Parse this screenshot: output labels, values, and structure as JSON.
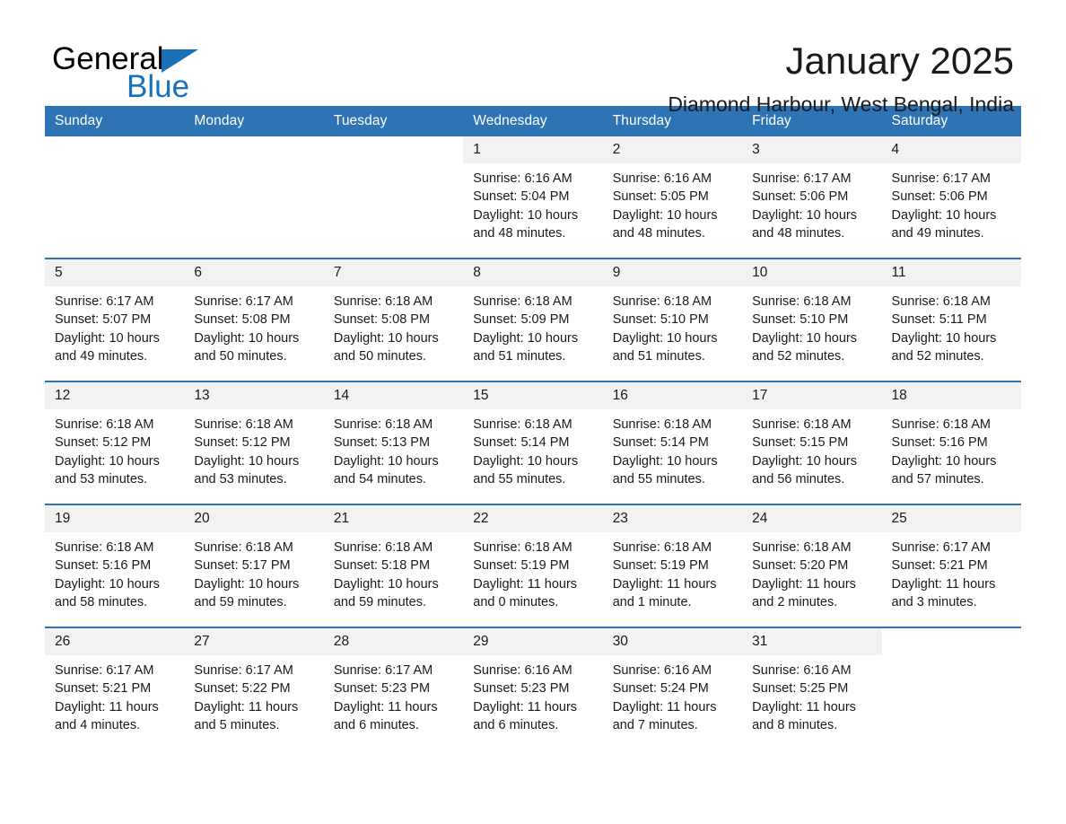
{
  "brand": {
    "line1": "General",
    "line2": "Blue",
    "triangle_icon": "triangle-icon",
    "black": "#000000",
    "blue": "#1a71b8"
  },
  "header": {
    "title": "January 2025",
    "subtitle": "Diamond Harbour, West Bengal, India"
  },
  "theme": {
    "header_blue": "#2e74b5",
    "row_divider": "#2e74b5",
    "daynum_band": "#f2f2f2",
    "text": "#1a1a1a"
  },
  "weekday_headers": [
    "Sunday",
    "Monday",
    "Tuesday",
    "Wednesday",
    "Thursday",
    "Friday",
    "Saturday"
  ],
  "weeks": [
    [
      {
        "day": "",
        "blank": true
      },
      {
        "day": "",
        "blank": true
      },
      {
        "day": "",
        "blank": true
      },
      {
        "day": "1",
        "sunrise": "Sunrise: 6:16 AM",
        "sunset": "Sunset: 5:04 PM",
        "daylight": "Daylight: 10 hours and 48 minutes."
      },
      {
        "day": "2",
        "sunrise": "Sunrise: 6:16 AM",
        "sunset": "Sunset: 5:05 PM",
        "daylight": "Daylight: 10 hours and 48 minutes."
      },
      {
        "day": "3",
        "sunrise": "Sunrise: 6:17 AM",
        "sunset": "Sunset: 5:06 PM",
        "daylight": "Daylight: 10 hours and 48 minutes."
      },
      {
        "day": "4",
        "sunrise": "Sunrise: 6:17 AM",
        "sunset": "Sunset: 5:06 PM",
        "daylight": "Daylight: 10 hours and 49 minutes."
      }
    ],
    [
      {
        "day": "5",
        "sunrise": "Sunrise: 6:17 AM",
        "sunset": "Sunset: 5:07 PM",
        "daylight": "Daylight: 10 hours and 49 minutes."
      },
      {
        "day": "6",
        "sunrise": "Sunrise: 6:17 AM",
        "sunset": "Sunset: 5:08 PM",
        "daylight": "Daylight: 10 hours and 50 minutes."
      },
      {
        "day": "7",
        "sunrise": "Sunrise: 6:18 AM",
        "sunset": "Sunset: 5:08 PM",
        "daylight": "Daylight: 10 hours and 50 minutes."
      },
      {
        "day": "8",
        "sunrise": "Sunrise: 6:18 AM",
        "sunset": "Sunset: 5:09 PM",
        "daylight": "Daylight: 10 hours and 51 minutes."
      },
      {
        "day": "9",
        "sunrise": "Sunrise: 6:18 AM",
        "sunset": "Sunset: 5:10 PM",
        "daylight": "Daylight: 10 hours and 51 minutes."
      },
      {
        "day": "10",
        "sunrise": "Sunrise: 6:18 AM",
        "sunset": "Sunset: 5:10 PM",
        "daylight": "Daylight: 10 hours and 52 minutes."
      },
      {
        "day": "11",
        "sunrise": "Sunrise: 6:18 AM",
        "sunset": "Sunset: 5:11 PM",
        "daylight": "Daylight: 10 hours and 52 minutes."
      }
    ],
    [
      {
        "day": "12",
        "sunrise": "Sunrise: 6:18 AM",
        "sunset": "Sunset: 5:12 PM",
        "daylight": "Daylight: 10 hours and 53 minutes."
      },
      {
        "day": "13",
        "sunrise": "Sunrise: 6:18 AM",
        "sunset": "Sunset: 5:12 PM",
        "daylight": "Daylight: 10 hours and 53 minutes."
      },
      {
        "day": "14",
        "sunrise": "Sunrise: 6:18 AM",
        "sunset": "Sunset: 5:13 PM",
        "daylight": "Daylight: 10 hours and 54 minutes."
      },
      {
        "day": "15",
        "sunrise": "Sunrise: 6:18 AM",
        "sunset": "Sunset: 5:14 PM",
        "daylight": "Daylight: 10 hours and 55 minutes."
      },
      {
        "day": "16",
        "sunrise": "Sunrise: 6:18 AM",
        "sunset": "Sunset: 5:14 PM",
        "daylight": "Daylight: 10 hours and 55 minutes."
      },
      {
        "day": "17",
        "sunrise": "Sunrise: 6:18 AM",
        "sunset": "Sunset: 5:15 PM",
        "daylight": "Daylight: 10 hours and 56 minutes."
      },
      {
        "day": "18",
        "sunrise": "Sunrise: 6:18 AM",
        "sunset": "Sunset: 5:16 PM",
        "daylight": "Daylight: 10 hours and 57 minutes."
      }
    ],
    [
      {
        "day": "19",
        "sunrise": "Sunrise: 6:18 AM",
        "sunset": "Sunset: 5:16 PM",
        "daylight": "Daylight: 10 hours and 58 minutes."
      },
      {
        "day": "20",
        "sunrise": "Sunrise: 6:18 AM",
        "sunset": "Sunset: 5:17 PM",
        "daylight": "Daylight: 10 hours and 59 minutes."
      },
      {
        "day": "21",
        "sunrise": "Sunrise: 6:18 AM",
        "sunset": "Sunset: 5:18 PM",
        "daylight": "Daylight: 10 hours and 59 minutes."
      },
      {
        "day": "22",
        "sunrise": "Sunrise: 6:18 AM",
        "sunset": "Sunset: 5:19 PM",
        "daylight": "Daylight: 11 hours and 0 minutes."
      },
      {
        "day": "23",
        "sunrise": "Sunrise: 6:18 AM",
        "sunset": "Sunset: 5:19 PM",
        "daylight": "Daylight: 11 hours and 1 minute."
      },
      {
        "day": "24",
        "sunrise": "Sunrise: 6:18 AM",
        "sunset": "Sunset: 5:20 PM",
        "daylight": "Daylight: 11 hours and 2 minutes."
      },
      {
        "day": "25",
        "sunrise": "Sunrise: 6:17 AM",
        "sunset": "Sunset: 5:21 PM",
        "daylight": "Daylight: 11 hours and 3 minutes."
      }
    ],
    [
      {
        "day": "26",
        "sunrise": "Sunrise: 6:17 AM",
        "sunset": "Sunset: 5:21 PM",
        "daylight": "Daylight: 11 hours and 4 minutes."
      },
      {
        "day": "27",
        "sunrise": "Sunrise: 6:17 AM",
        "sunset": "Sunset: 5:22 PM",
        "daylight": "Daylight: 11 hours and 5 minutes."
      },
      {
        "day": "28",
        "sunrise": "Sunrise: 6:17 AM",
        "sunset": "Sunset: 5:23 PM",
        "daylight": "Daylight: 11 hours and 6 minutes."
      },
      {
        "day": "29",
        "sunrise": "Sunrise: 6:16 AM",
        "sunset": "Sunset: 5:23 PM",
        "daylight": "Daylight: 11 hours and 6 minutes."
      },
      {
        "day": "30",
        "sunrise": "Sunrise: 6:16 AM",
        "sunset": "Sunset: 5:24 PM",
        "daylight": "Daylight: 11 hours and 7 minutes."
      },
      {
        "day": "31",
        "sunrise": "Sunrise: 6:16 AM",
        "sunset": "Sunset: 5:25 PM",
        "daylight": "Daylight: 11 hours and 8 minutes."
      },
      {
        "day": "",
        "blank": true
      }
    ]
  ]
}
